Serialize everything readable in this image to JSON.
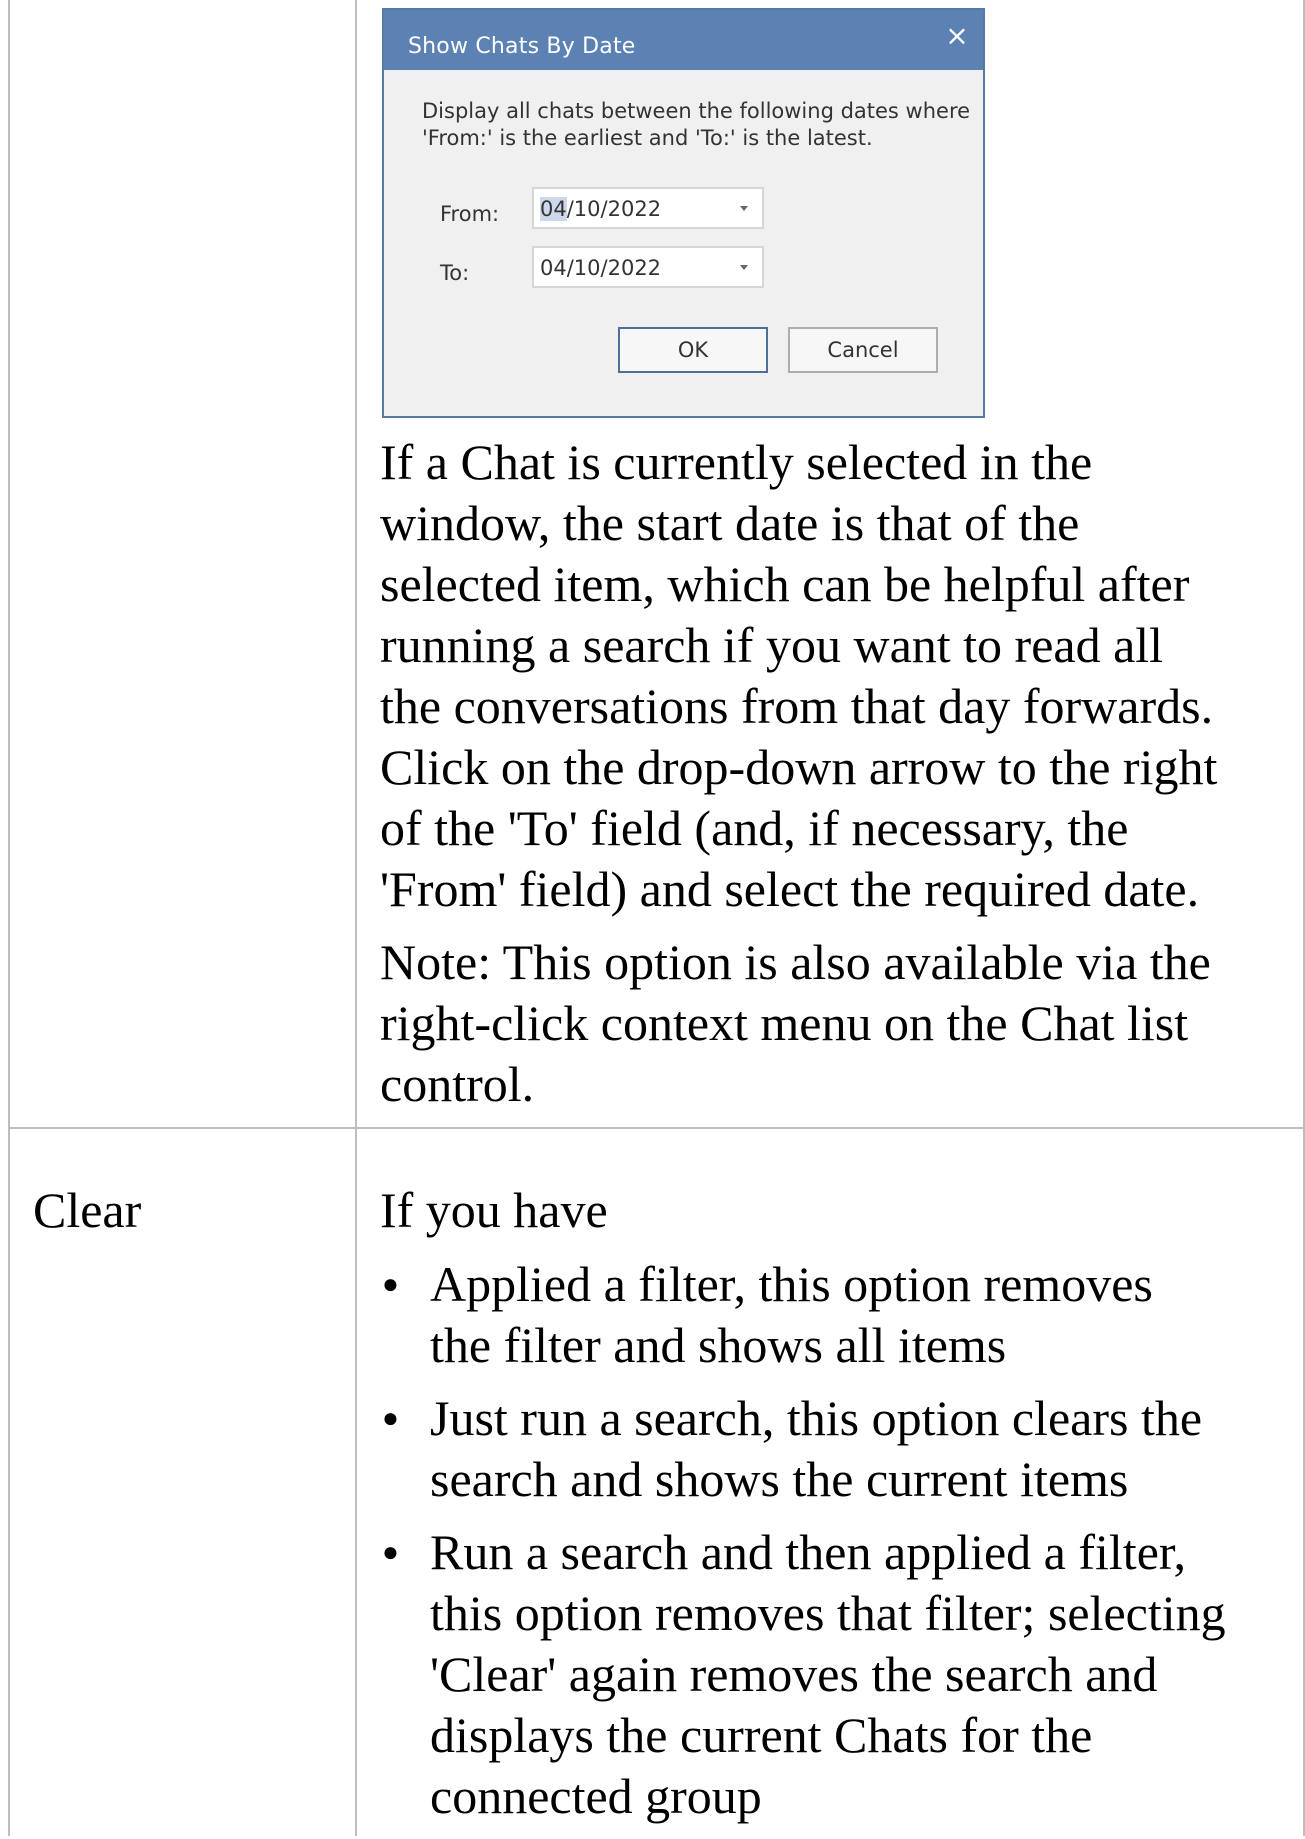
{
  "dialog": {
    "title": "Show Chats By Date",
    "close_glyph": "×",
    "description_line1": "Display all chats between the following dates where",
    "description_line2": "'From:' is the earliest and 'To:' is the latest.",
    "from_label": "From:",
    "from_value_highlight": "04",
    "from_value_rest": "/10/2022",
    "to_label": "To:",
    "to_value": "04/10/2022",
    "ok_label": "OK",
    "cancel_label": "Cancel",
    "colors": {
      "titlebar": "#5c82b4",
      "border": "#5879a6",
      "background": "#f0f0f0"
    }
  },
  "row1": {
    "para1_lines": [
      "If a Chat is currently selected in the",
      "window, the start date is that of the",
      "selected item, which can be helpful after",
      "running a search if you want to read all",
      "the conversations from that day forwards.",
      "Click on the drop-down arrow to the right",
      "of the 'To' field (and, if necessary, the",
      "'From' field) and select the required date."
    ],
    "note_lines": [
      "Note: This option is also available via the",
      "right-click context menu on the Chat list",
      "control."
    ]
  },
  "row2": {
    "label": "Clear",
    "intro": "If you have",
    "bullets": [
      {
        "lines": [
          "Applied a filter, this option removes",
          "the filter and shows all items"
        ]
      },
      {
        "lines": [
          "Just run a search, this option clears the",
          "search and shows the current items"
        ]
      },
      {
        "lines": [
          "Run a search and then applied a filter,",
          "this option removes that filter; selecting",
          "'Clear' again removes the search and",
          "displays the current Chats for the",
          "connected group"
        ]
      }
    ]
  }
}
